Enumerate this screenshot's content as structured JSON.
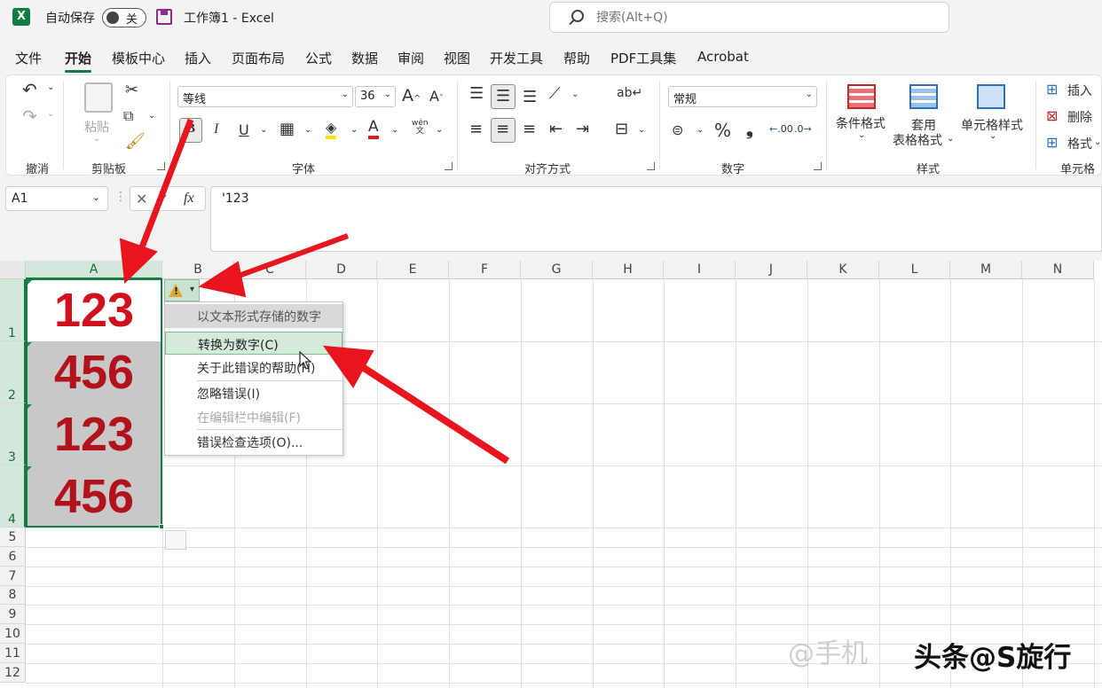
{
  "titlebar": {
    "app_icon": "X",
    "autosave_label": "自动保存",
    "autosave_state": "关",
    "document_title": "工作簿1  -  Excel",
    "search_placeholder": "搜索(Alt+Q)"
  },
  "menu_tabs": [
    "文件",
    "开始",
    "模板中心",
    "插入",
    "页面布局",
    "公式",
    "数据",
    "审阅",
    "视图",
    "开发工具",
    "帮助",
    "PDF工具集",
    "Acrobat"
  ],
  "active_tab": "开始",
  "ribbon": {
    "groups": {
      "undo": "撤消",
      "clipboard": "剪贴板",
      "font": "字体",
      "alignment": "对齐方式",
      "number": "数字",
      "styles": "样式",
      "cells": "单元格"
    },
    "paste_label": "粘贴",
    "font_name": "等线",
    "font_size": "36",
    "bold": "B",
    "italic": "I",
    "underline": "U",
    "number_format": "常规",
    "percent": "%",
    "comma": "❟",
    "cond_format": "条件格式",
    "table_format_1": "套用",
    "table_format_2": "表格格式",
    "cell_style": "单元格样式",
    "insert": "插入",
    "delete": "删除",
    "format": "格式",
    "wen": "wén",
    "wen_char": "文",
    "decimal_inc": ".00",
    "decimal_dec": ".0"
  },
  "formula_bar": {
    "name_box": "A1",
    "fx": "fx",
    "formula": "'123"
  },
  "columns": [
    "A",
    "B",
    "C",
    "D",
    "E",
    "F",
    "G",
    "H",
    "I",
    "J",
    "K",
    "L",
    "M",
    "N"
  ],
  "rows": [
    "1",
    "2",
    "3",
    "4",
    "5",
    "6",
    "7",
    "8",
    "9",
    "10",
    "11",
    "12"
  ],
  "cells": {
    "A1": "123",
    "A2": "456",
    "A3": "123",
    "A4": "456"
  },
  "error_menu": {
    "header": "以文本形式存储的数字",
    "items": [
      {
        "label": "转换为数字(C)",
        "state": "hover"
      },
      {
        "label": "关于此错误的帮助(H)",
        "state": "normal"
      },
      {
        "label": "忽略错误(I)",
        "state": "normal"
      },
      {
        "label": "在编辑栏中编辑(F)",
        "state": "disabled"
      },
      {
        "label": "错误检查选项(O)...",
        "state": "normal"
      }
    ]
  },
  "watermark": "@手机",
  "watermark_overlay": "头条@S旋行",
  "colors": {
    "excel_green": "#107c41",
    "cell_text_red": "#d0101a",
    "arrow_red": "#e8141e"
  }
}
